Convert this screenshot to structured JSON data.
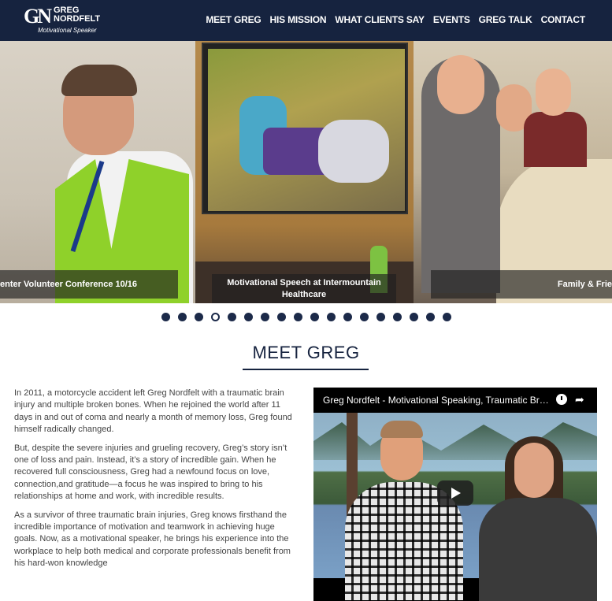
{
  "header": {
    "logo_mark": "GN",
    "logo_name_line1": "GREG",
    "logo_name_line2": "NORDFELT",
    "logo_tagline": "Motivational Speaker",
    "nav": [
      "MEET GREG",
      "HIS MISSION",
      "WHAT CLIENTS SAY",
      "EVENTS",
      "GREG TALK",
      "CONTACT"
    ]
  },
  "slider": {
    "captions": [
      "enter Volunteer Conference 10/16",
      "Motivational Speech at Intermountain Healthcare",
      "Family & Frie"
    ],
    "dot_count": 18,
    "active_dot": 4
  },
  "section": {
    "title": "MEET GREG"
  },
  "bio": {
    "p1": "In 2011, a motorcycle accident left Greg Nordfelt with a traumatic brain injury and multiple broken bones. When he rejoined the world after 11 days in and out of coma and nearly a month of memory loss, Greg found himself radically changed.",
    "p2": "But, despite the severe injuries and grueling recovery, Greg’s story isn’t one of loss and pain. Instead, it’s a story of incredible gain. When he recovered full consciousness, Greg had a newfound focus on love, connection,and gratitude—a focus he was inspired to bring to his relationships at home and work, with incredible results.",
    "p3": "As a survivor of three traumatic brain injuries, Greg knows firsthand the incredible importance of motivation and teamwork in achieving huge goals. Now, as a motivational speaker, he brings his experience into the workplace to help both medical and corporate professionals benefit from his hard-won knowledge"
  },
  "video": {
    "title": "Greg Nordfelt - Motivational Speaking, Traumatic Brain Injury",
    "icons": [
      "clock-icon",
      "share-icon",
      "play-icon"
    ]
  },
  "colors": {
    "header_bg": "#16233f",
    "accent": "#1c2a49"
  }
}
